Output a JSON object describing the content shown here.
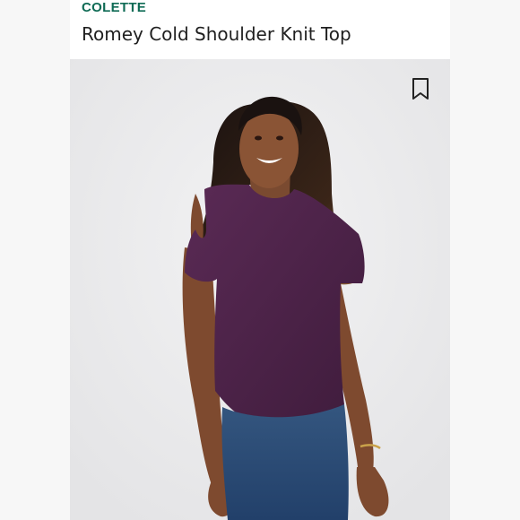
{
  "product": {
    "brand": "COLETTE",
    "title": "Romey Cold Shoulder Knit Top"
  },
  "icons": {
    "bookmark": "bookmark-icon"
  },
  "colors": {
    "brand": "#0f6b55",
    "top": "#4b2447",
    "jeans": "#2e4e7a"
  }
}
